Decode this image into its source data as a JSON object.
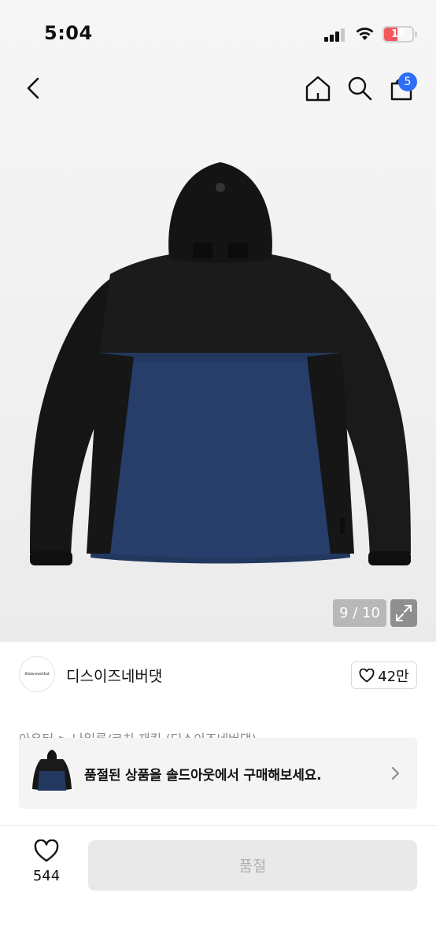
{
  "status_bar": {
    "time": "5:04",
    "battery_percent": "17",
    "battery_level": 0.17,
    "battery_color": "#f2575c"
  },
  "top_nav": {
    "back_icon": "chevron-left-icon",
    "home_icon": "home-icon",
    "search_icon": "search-icon",
    "bag_icon": "shopping-bag-icon",
    "bag_count": "5",
    "badge_color": "#2f6df6"
  },
  "gallery": {
    "counter": "9 / 10",
    "expand_icon": "expand-icon"
  },
  "brand": {
    "logo_text": "thisisneverthat",
    "name": "디스이즈네버댓",
    "likes": "42만"
  },
  "breadcrumb": "아우터 > 나일론/코치 재킷 (디스이즈네버댓)",
  "soldout_banner": {
    "text": "품절된 상품을 솔드아웃에서 구매해보세요."
  },
  "bottom_bar": {
    "wish_count": "544",
    "buy_label": "품절"
  }
}
